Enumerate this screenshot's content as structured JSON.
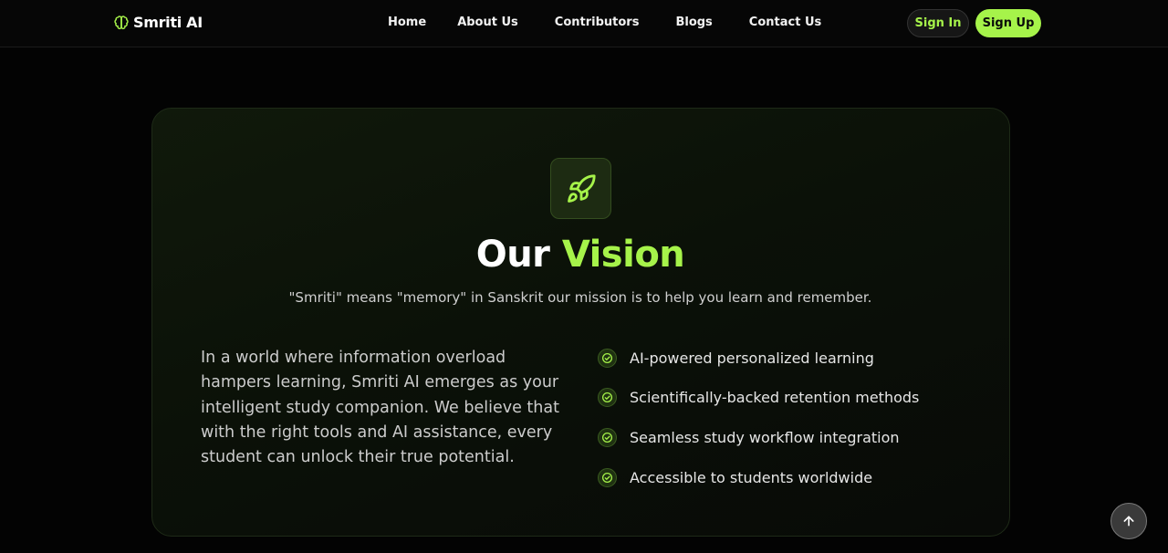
{
  "brand": {
    "name": "Smriti AI",
    "icon": "brain-icon",
    "accent_color": "#a6f34a"
  },
  "nav": {
    "links": [
      {
        "label": "Home"
      },
      {
        "label": "About Us"
      },
      {
        "label": "Contributors"
      },
      {
        "label": "Blogs"
      },
      {
        "label": "Contact Us"
      }
    ],
    "sign_in_label": "Sign In",
    "sign_up_label": "Sign Up"
  },
  "vision": {
    "icon": "rocket-icon",
    "title_main": "Our",
    "title_accent": "Vision",
    "subtitle": "\"Smriti\" means \"memory\" in Sanskrit our mission is to help you learn and remember.",
    "intro": "In a world where information overload hampers learning, Smriti AI emerges as your intelligent study companion. We believe that with the right tools and AI assistance, every student can unlock their true potential.",
    "features": [
      {
        "text": "AI-powered personalized learning",
        "icon": "check-circle-icon"
      },
      {
        "text": "Scientifically-backed retention methods",
        "icon": "check-circle-icon"
      },
      {
        "text": "Seamless study workflow integration",
        "icon": "check-circle-icon"
      },
      {
        "text": "Accessible to students worldwide",
        "icon": "check-circle-icon"
      }
    ]
  },
  "scroll_top": {
    "icon": "arrow-up-icon"
  }
}
